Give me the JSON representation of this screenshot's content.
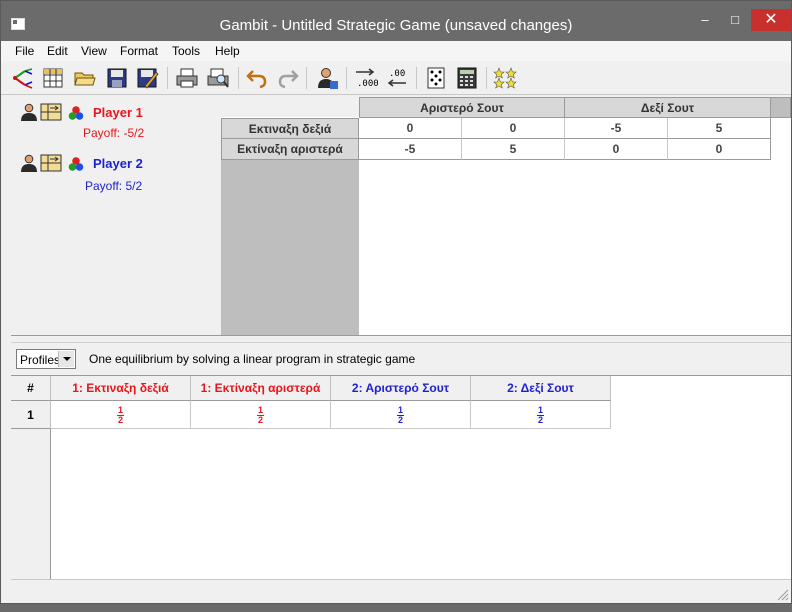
{
  "window": {
    "title": "Gambit - Untitled Strategic Game (unsaved changes)",
    "minimize": "–",
    "maximize": "□",
    "close": "✕"
  },
  "menu": [
    "File",
    "Edit",
    "View",
    "Format",
    "Tools",
    "Help"
  ],
  "toolbar_icons": [
    "new-extensive-icon",
    "new-strategic-icon",
    "open-icon",
    "save-icon",
    "save-as-icon",
    "print-icon",
    "print-preview-icon",
    "undo-icon",
    "redo-icon",
    "add-player-icon",
    "decimal-precision-icon",
    "decrease-precision-icon",
    "dominance-icon",
    "calculator-icon",
    "nash-stars-icon"
  ],
  "players": [
    {
      "name": "Player 1",
      "payoff": "Payoff: -5/2",
      "color": "#e8161c"
    },
    {
      "name": "Player 2",
      "payoff": "Payoff: 5/2",
      "color": "#1f1fd0"
    }
  ],
  "matrix": {
    "col_strategies": [
      "Αριστερό Σουτ",
      "Δεξί Σουτ"
    ],
    "row_strategies": [
      "Εκτιναξη δεξιά",
      "Εκτίναξη αριστερά"
    ],
    "payoffs": [
      [
        "0",
        "0",
        "-5",
        "5"
      ],
      [
        "-5",
        "5",
        "0",
        "0"
      ]
    ]
  },
  "profiles": {
    "selector": "Profiles",
    "message": "One equilibrium by solving a linear program in strategic game",
    "headers": [
      "#",
      "1: Εκτιναξη δεξιά",
      "1: Εκτίναξη αριστερά",
      "2: Αριστερό Σουτ",
      "2: Δεξί Σουτ"
    ],
    "rows": [
      {
        "index": "1",
        "values": [
          {
            "num": "1",
            "den": "2"
          },
          {
            "num": "1",
            "den": "2"
          },
          {
            "num": "1",
            "den": "2"
          },
          {
            "num": "1",
            "den": "2"
          }
        ]
      }
    ]
  }
}
